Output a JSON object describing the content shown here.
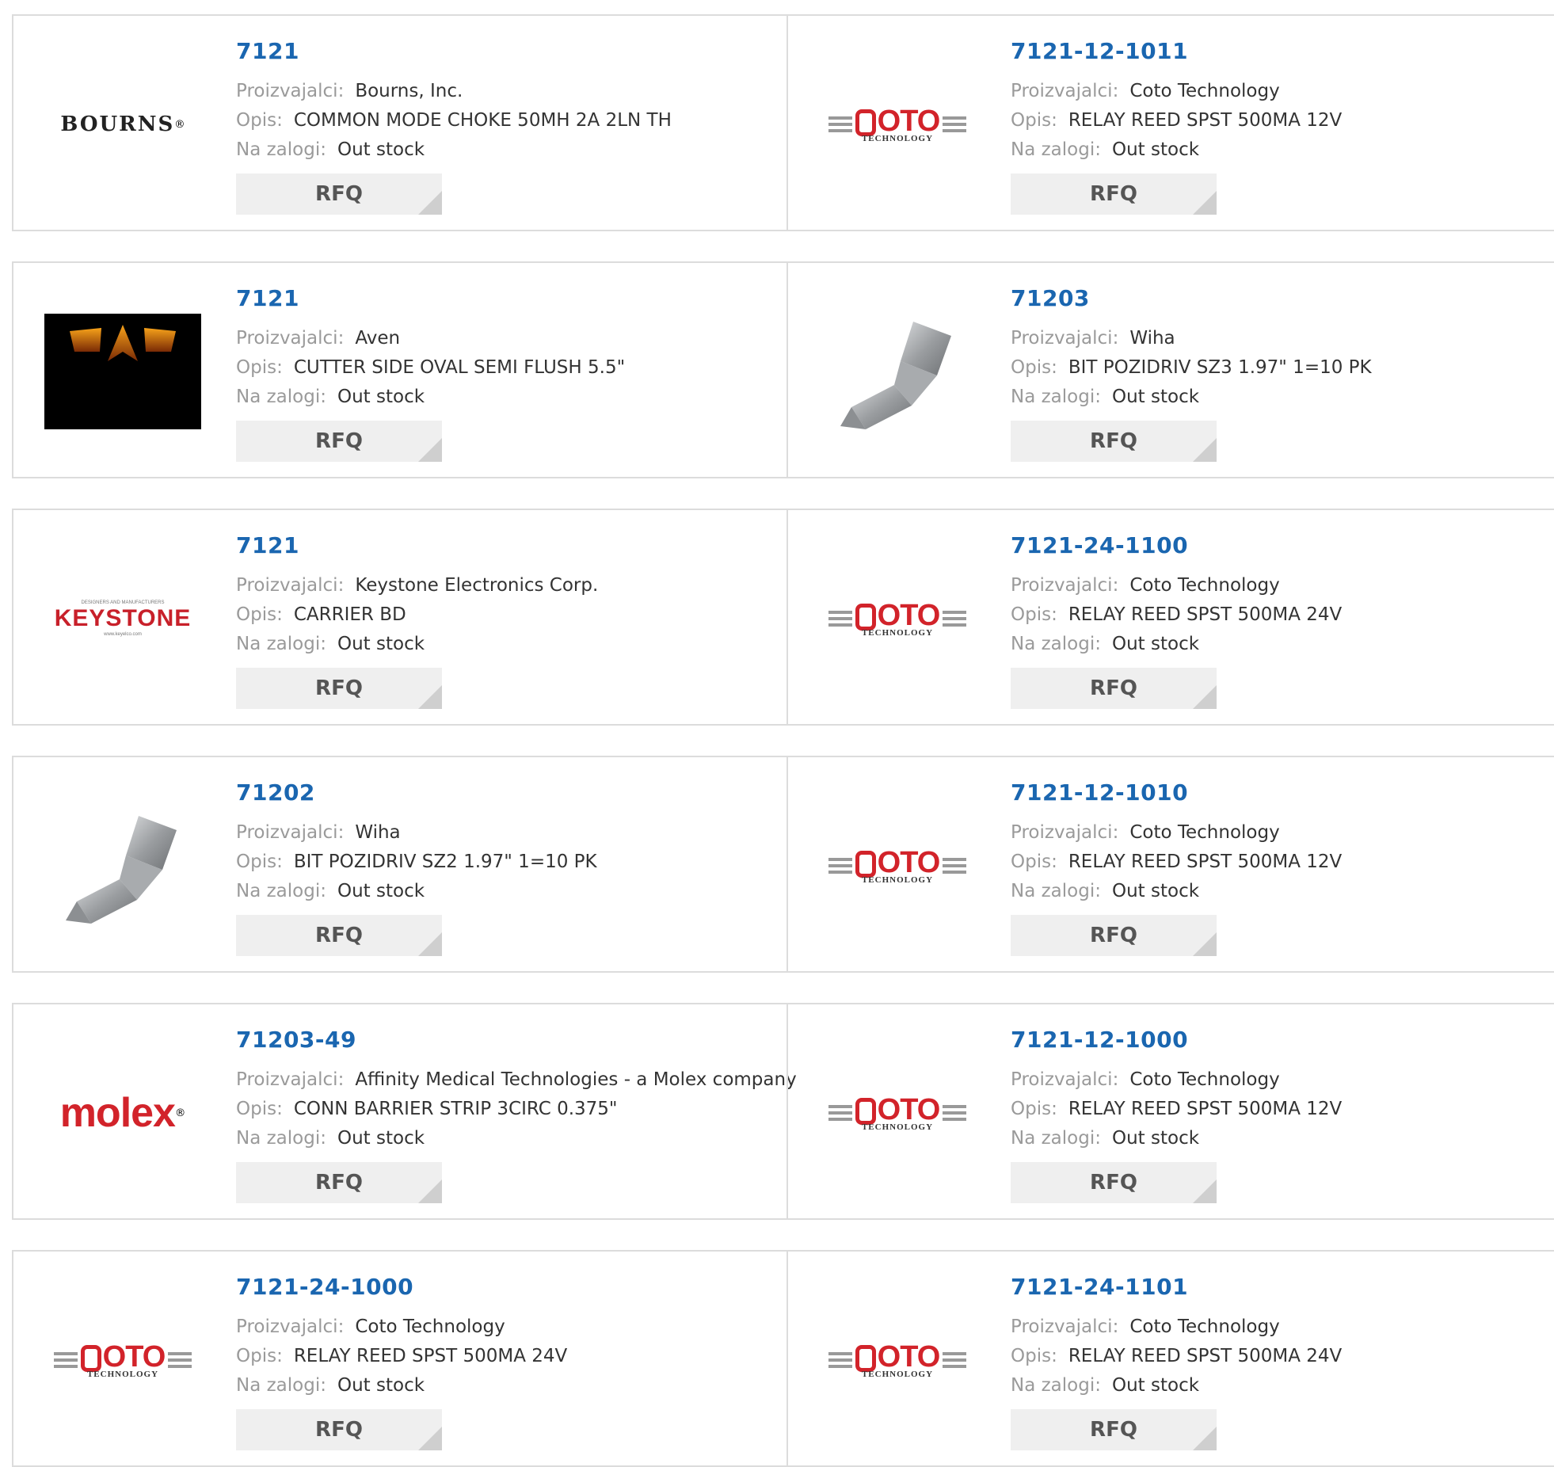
{
  "labels": {
    "manufacturer": "Proizvajalci:",
    "description": "Opis:",
    "stock": "Na zalogi:",
    "rfq": "RFQ"
  },
  "products": [
    {
      "part": "7121",
      "manufacturer": "Bourns, Inc.",
      "description": "COMMON MODE CHOKE 50MH 2A 2LN TH",
      "stock": "Out stock",
      "logo": "BOURNS"
    },
    {
      "part": "7121-12-1011",
      "manufacturer": "Coto Technology",
      "description": "RELAY REED SPST 500MA 12V",
      "stock": "Out stock",
      "logo": "OTO"
    },
    {
      "part": "7121",
      "manufacturer": "Aven",
      "description": "CUTTER SIDE OVAL SEMI FLUSH 5.5\"",
      "stock": "Out stock",
      "logo": "aven-logo"
    },
    {
      "part": "71203",
      "manufacturer": "Wiha",
      "description": "BIT POZIDRIV SZ3 1.97\" 1=10 PK",
      "stock": "Out stock",
      "logo": "screwdriver-bit-image"
    },
    {
      "part": "7121",
      "manufacturer": "Keystone Electronics Corp.",
      "description": "CARRIER BD",
      "stock": "Out stock",
      "logo": "KEYSTONE"
    },
    {
      "part": "7121-24-1100",
      "manufacturer": "Coto Technology",
      "description": "RELAY REED SPST 500MA 24V",
      "stock": "Out stock",
      "logo": "OTO"
    },
    {
      "part": "71202",
      "manufacturer": "Wiha",
      "description": "BIT POZIDRIV SZ2 1.97\" 1=10 PK",
      "stock": "Out stock",
      "logo": "screwdriver-bit-image"
    },
    {
      "part": "7121-12-1010",
      "manufacturer": "Coto Technology",
      "description": "RELAY REED SPST 500MA 12V",
      "stock": "Out stock",
      "logo": "OTO"
    },
    {
      "part": "71203-49",
      "manufacturer": "Affinity Medical Technologies - a Molex company",
      "description": "CONN BARRIER STRIP 3CIRC 0.375\"",
      "stock": "Out stock",
      "logo": "molex"
    },
    {
      "part": "7121-12-1000",
      "manufacturer": "Coto Technology",
      "description": "RELAY REED SPST 500MA 12V",
      "stock": "Out stock",
      "logo": "OTO"
    },
    {
      "part": "7121-24-1000",
      "manufacturer": "Coto Technology",
      "description": "RELAY REED SPST 500MA 24V",
      "stock": "Out stock",
      "logo": "OTO"
    },
    {
      "part": "7121-24-1101",
      "manufacturer": "Coto Technology",
      "description": "RELAY REED SPST 500MA 24V",
      "stock": "Out stock",
      "logo": "OTO"
    }
  ],
  "logo_text": {
    "bourns": "BOURNS",
    "coto_word": "OTO",
    "coto_sub": "TECHNOLOGY",
    "keystone": "KEYSTONE",
    "keystone_top": "DESIGNERS AND MANUFACTURERS",
    "keystone_bottom": "www.keyelco.com",
    "molex": "molex"
  },
  "colors": {
    "part_link": "#1a66b0",
    "label": "#9a9a9a",
    "value": "#333333",
    "rfq_bg": "#efefef",
    "brand_red": "#d2232a",
    "border": "#dcdcdc"
  }
}
